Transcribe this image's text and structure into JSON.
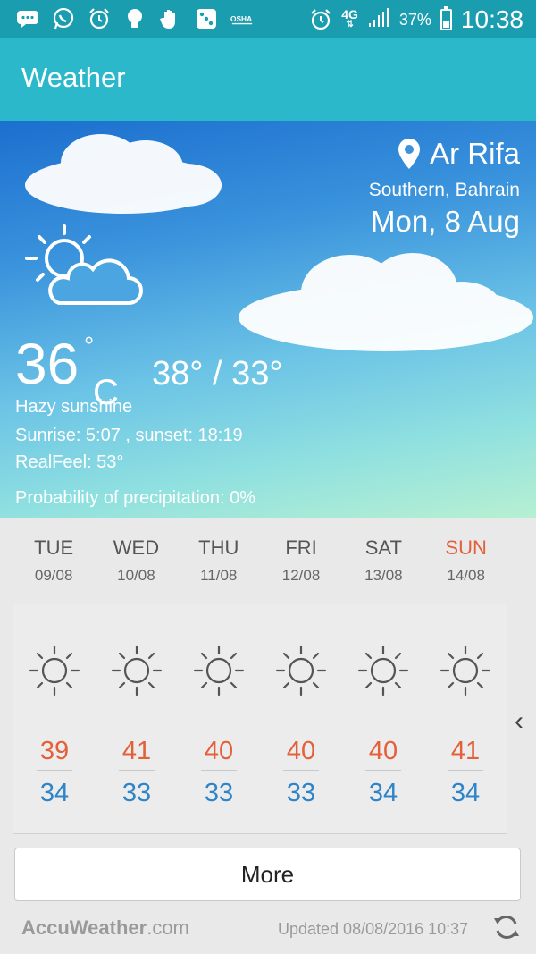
{
  "status_bar": {
    "network": "4G",
    "battery_percent": "37%",
    "battery_level": 0.37,
    "time": "10:38",
    "left_icons": [
      "message-icon",
      "whatsapp-icon",
      "alarm-icon",
      "lightbulb-icon",
      "hand-icon",
      "dice-icon",
      "osha-icon"
    ],
    "osha_text": "OSHA"
  },
  "app_bar": {
    "title": "Weather"
  },
  "current": {
    "location": "Ar Rifa",
    "region": "Southern, Bahrain",
    "date": "Mon, 8 Aug",
    "temperature": "36",
    "degree": "°",
    "unit": "C",
    "hi_lo": "38° / 33°",
    "condition": "Hazy sunshine",
    "sun_times": "Sunrise: 5:07 , sunset: 18:19",
    "realfeel": "RealFeel: 53°",
    "precipitation": "Probability of precipitation: 0%",
    "icon": "partly-sunny-icon"
  },
  "forecast": [
    {
      "day": "TUE",
      "date": "09/08",
      "high": "39",
      "low": "34",
      "icon": "sun-icon"
    },
    {
      "day": "WED",
      "date": "10/08",
      "high": "41",
      "low": "33",
      "icon": "sun-icon"
    },
    {
      "day": "THU",
      "date": "11/08",
      "high": "40",
      "low": "33",
      "icon": "sun-icon"
    },
    {
      "day": "FRI",
      "date": "12/08",
      "high": "40",
      "low": "33",
      "icon": "sun-icon"
    },
    {
      "day": "SAT",
      "date": "13/08",
      "high": "40",
      "low": "34",
      "icon": "sun-icon"
    },
    {
      "day": "SUN",
      "date": "14/08",
      "high": "41",
      "low": "34",
      "icon": "sun-icon"
    }
  ],
  "colors": {
    "status_bar": "#1b9db0",
    "app_bar": "#2bb8cb",
    "high_temp": "#e3603a",
    "low_temp": "#2e84c9",
    "weekend": "#e3603a"
  },
  "more_label": "More",
  "footer": {
    "brand_bold": "AccuWeather",
    "brand_suffix": ".com",
    "updated": "Updated 08/08/2016 10:37"
  }
}
